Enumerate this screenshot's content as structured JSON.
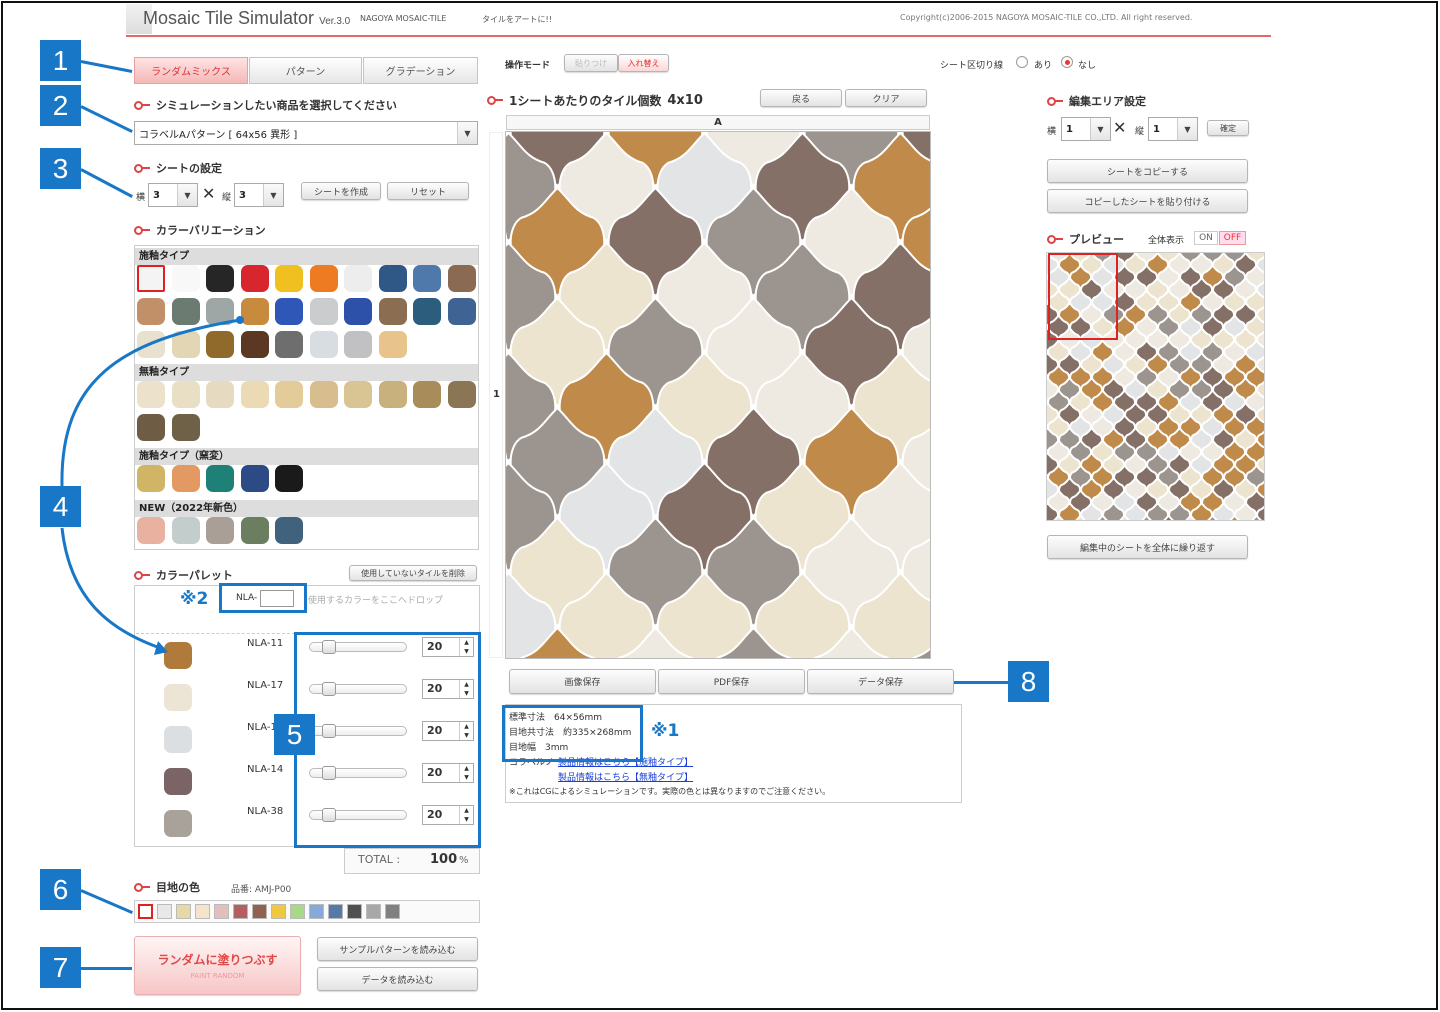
{
  "header": {
    "title": "Mosaic Tile Simulator",
    "version": "Ver.3.0",
    "company": "NAGOYA MOSAIC-TILE",
    "tagline": "タイルをアートに!!",
    "copyright": "Copyright(c)2006-2015 NAGOYA MOSAIC-TILE CO.,LTD. All right reserved."
  },
  "tabs": [
    {
      "label": "ランダムミックス"
    },
    {
      "label": "パターン"
    },
    {
      "label": "グラデーション"
    }
  ],
  "product": {
    "title": "シミュレーションしたい商品を選択してください",
    "selected": "コラベルAパターン [ 64x56 異形 ]"
  },
  "sheet": {
    "title": "シートの設定",
    "w_label": "横",
    "w_value": "3",
    "h_label": "縦",
    "h_value": "3",
    "create_btn": "シートを作成",
    "reset_btn": "リセット"
  },
  "variation": {
    "title": "カラーバリエーション",
    "categories": [
      {
        "name": "施釉タイプ",
        "colors": [
          "#f4f4f4",
          "#f8f8f8",
          "#262626",
          "#d8262f",
          "#f0c020",
          "#ee7a22",
          "#ededed",
          "#2f5886",
          "#4e79aa",
          "#8a6a53",
          "#c29068",
          "#6c7b72",
          "#9fa7a6",
          "#c88a3c",
          "#2f57b7",
          "#caccce",
          "#2d51a8",
          "#8b6d52",
          "#2d5d7d",
          "#3f6392",
          "#e8e1cf",
          "#e2d6b5",
          "#8f6a2a",
          "#5a3823",
          "#6e6e6e",
          "#d8dde2",
          "#c1c1c3",
          "#e8c48c"
        ]
      },
      {
        "name": "無釉タイプ",
        "colors": [
          "#ece2cc",
          "#e9dfc5",
          "#e6dac0",
          "#ebdab4",
          "#e3cc9a",
          "#d8bd8f",
          "#d9c493",
          "#c8b17c",
          "#a88d5a",
          "#8a7654",
          "#6e5d44",
          "#6e6147"
        ]
      },
      {
        "name": "施釉タイプ（窯変）",
        "colors": [
          "#d1b566",
          "#e39a62",
          "#1f8078",
          "#2c4a86",
          "#1a1a1a"
        ]
      },
      {
        "name": "NEW（2022年新色）",
        "colors": [
          "#e9b2a0",
          "#c3cdcc",
          "#aa9f97",
          "#6b7e60",
          "#40627c"
        ]
      }
    ]
  },
  "palette": {
    "title": "カラーパレット",
    "delete_btn": "使用していないタイルを削除",
    "nla_prefix": "NLA-",
    "drop_hint": "使用するカラーをここへドロップ",
    "note": "※2",
    "items": [
      {
        "code": "NLA-11",
        "value": "20",
        "color": "#b07a3a"
      },
      {
        "code": "NLA-17",
        "value": "20",
        "color": "#ece4d4"
      },
      {
        "code": "NLA-1",
        "value": "20",
        "color": "#dcdfe2"
      },
      {
        "code": "NLA-14",
        "value": "20",
        "color": "#7b6466"
      },
      {
        "code": "NLA-38",
        "value": "20",
        "color": "#a8a29a"
      }
    ],
    "total_label": "TOTAL :",
    "total_value": "100",
    "total_unit": "%"
  },
  "grout": {
    "title": "目地の色",
    "code": "品番: AMJ-P00",
    "colors": [
      "#ffffff",
      "#e8e8e8",
      "#e8d8a8",
      "#f4e4cc",
      "#e0c0b8",
      "#b06060",
      "#906050",
      "#f0c840",
      "#a8d888",
      "#88a8d8",
      "#5878a8",
      "#505050",
      "#a8a8a8",
      "#808080"
    ]
  },
  "actions": {
    "paint_random": "ランダムに塗りつぶす",
    "paint_random_sub": "PAINT RANDOM",
    "sample": "サンプルパターンを読み込む",
    "load": "データを読み込む"
  },
  "mode": {
    "label": "操作モード",
    "paste": "貼りつけ",
    "swap": "入れ替え",
    "divider_label": "シート区切り線",
    "on": "あり",
    "off": "なし"
  },
  "canvas": {
    "title": "1シートあたりのタイル個数",
    "count": "4x10",
    "back": "戻る",
    "clear": "クリア",
    "col_label": "A",
    "row_label": "1"
  },
  "save": {
    "image": "画像保存",
    "pdf": "PDF保存",
    "data": "データ保存"
  },
  "info": {
    "size": "標準寸法　64×56mm",
    "grout_size": "目地共寸法　約335×268mm",
    "grout_width": "目地幅　3mm",
    "link_prefix": "コラベルノ",
    "link1": "製品情報はこちら【施釉タイプ】",
    "link2": "製品情報はこちら【無釉タイプ】",
    "note": "※これはCGによるシミュレーションです。実際の色とは異なりますのでご注意ください。",
    "star": "※1"
  },
  "edit_area": {
    "title": "編集エリア設定",
    "w_label": "横",
    "w_value": "1",
    "h_label": "縦",
    "h_value": "1",
    "confirm": "確定",
    "copy": "シートをコピーする",
    "paste": "コピーしたシートを貼り付ける"
  },
  "preview": {
    "title": "プレビュー",
    "fullview": "全体表示",
    "on": "ON",
    "off": "OFF",
    "repeat": "編集中のシートを全体に繰り返す"
  },
  "callouts": [
    "1",
    "2",
    "3",
    "4",
    "5",
    "6",
    "7",
    "8"
  ],
  "tile_colors": {
    "amber": "#c08a4a",
    "white": "#eeeae2",
    "gray": "#9c948e",
    "taupe": "#857068",
    "ice": "#e2e4e6",
    "cream": "#ede4cf"
  }
}
